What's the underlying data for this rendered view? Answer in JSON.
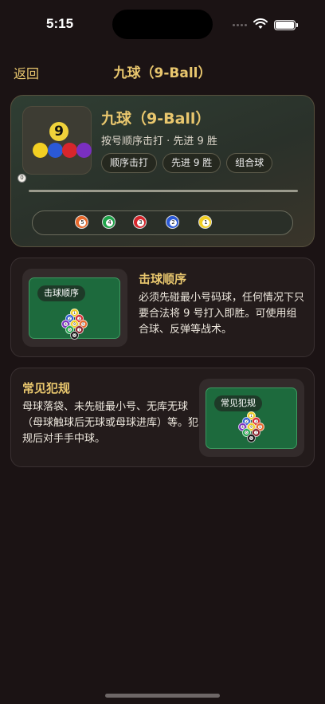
{
  "status": {
    "time": "5:15"
  },
  "nav": {
    "back_label": "返回",
    "title": "九球（9-Ball）"
  },
  "hero": {
    "icon_number": "9",
    "cue_number": "0",
    "title": "九球（9-Ball）",
    "subtitle": "按号顺序击打 · 先进 9 胜",
    "chips": [
      "顺序击打",
      "先进 9 胜",
      "组合球"
    ],
    "rail_balls": [
      {
        "number": "5",
        "color": "#e8692b"
      },
      {
        "number": "4",
        "color": "#1fa34a"
      },
      {
        "number": "3",
        "color": "#d7262c"
      },
      {
        "number": "2",
        "color": "#2b59d6"
      },
      {
        "number": "1",
        "color": "#f2cf22"
      }
    ]
  },
  "cards": [
    {
      "title": "击球顺序",
      "table_label": "击球顺序",
      "body": "必须先碰最小号码球，任何情况下只要合法将 9 号打入即胜。可使用组合球、反弹等战术。"
    },
    {
      "title": "常见犯规",
      "table_label": "常见犯规",
      "body": "母球落袋、未先碰最小号、无库无球（母球触球后无球或母球进库）等。犯规后对手手中球。"
    }
  ],
  "rack": {
    "balls": [
      {
        "number": "1",
        "color": "#f2cf22"
      },
      {
        "number": "2",
        "color": "#2b59d6"
      },
      {
        "number": "3",
        "color": "#d7262c"
      },
      {
        "number": "4",
        "color": "#7a2fc0"
      },
      {
        "number": "9",
        "color": "#f2cf22"
      },
      {
        "number": "5",
        "color": "#e8692b"
      },
      {
        "number": "6",
        "color": "#1fa34a"
      },
      {
        "number": "7",
        "color": "#8b1f28"
      },
      {
        "number": "8",
        "color": "#111111"
      }
    ]
  },
  "colors": {
    "accent": "#e9c76e",
    "background": "#1b1314",
    "felt": "#1d6a3d"
  }
}
